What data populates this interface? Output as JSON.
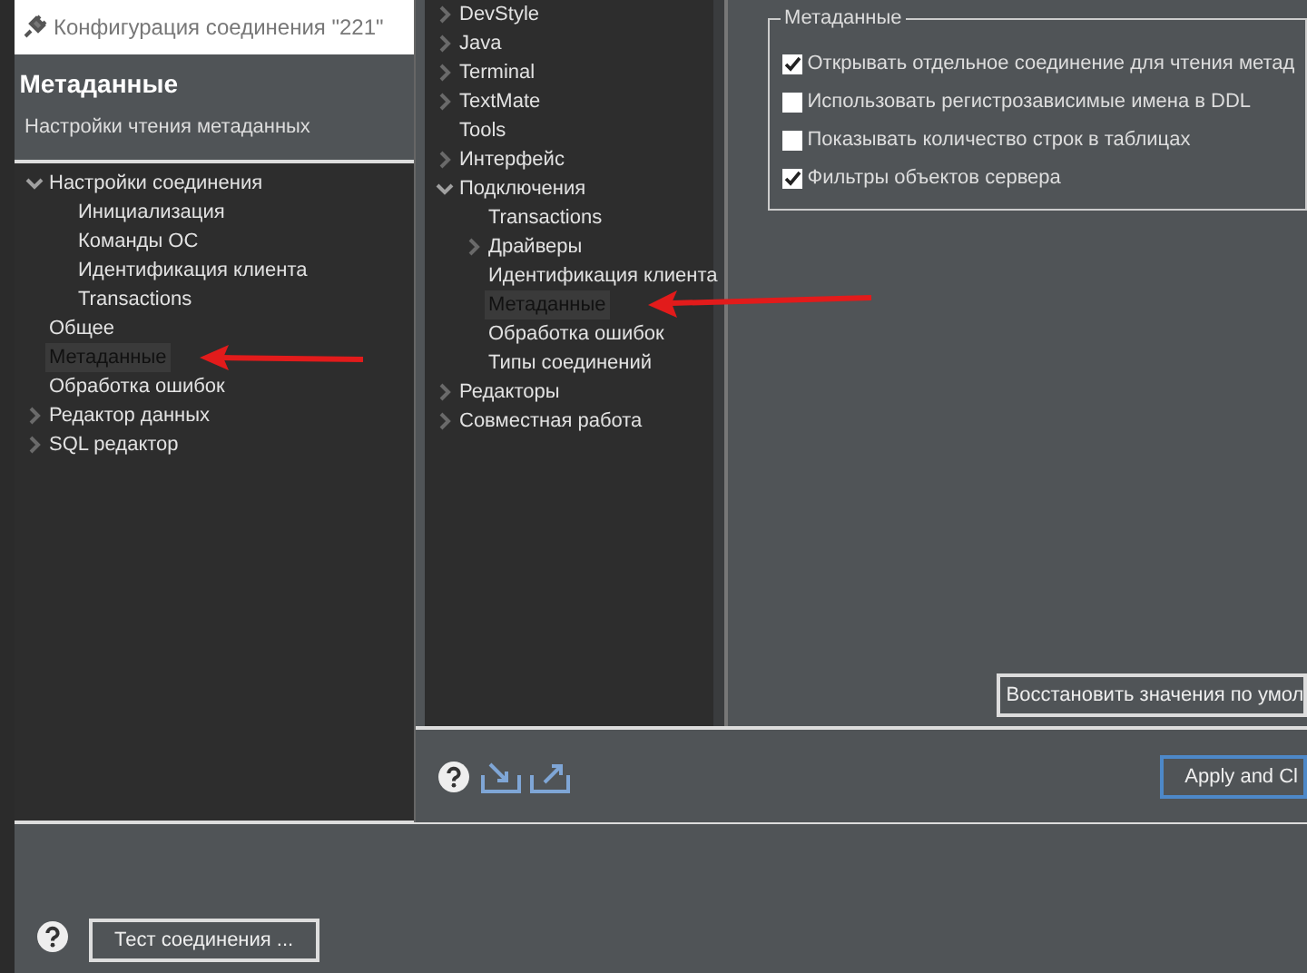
{
  "connection_dialog": {
    "title": "Конфигурация соединения \"221\"",
    "header": {
      "title": "Метаданные",
      "subtitle": "Настройки чтения метаданных"
    },
    "tree": [
      {
        "label": "Настройки соединения",
        "expanded": true,
        "selected": false,
        "children": [
          {
            "label": "Инициализация",
            "selected": false
          },
          {
            "label": "Команды ОС",
            "selected": false
          },
          {
            "label": "Идентификация клиента",
            "selected": false
          },
          {
            "label": "Transactions",
            "selected": false
          }
        ]
      },
      {
        "label": "Общее",
        "selected": false
      },
      {
        "label": "Метаданные",
        "selected": true
      },
      {
        "label": "Обработка ошибок",
        "selected": false
      },
      {
        "label": "Редактор данных",
        "expanded": false,
        "selected": false
      },
      {
        "label": "SQL редактор",
        "expanded": false,
        "selected": false
      }
    ],
    "test_button": "Тест соединения ..."
  },
  "preferences": {
    "tree": [
      {
        "label": "DevStyle",
        "expanded": false,
        "selected": false
      },
      {
        "label": "Java",
        "expanded": false,
        "selected": false
      },
      {
        "label": "Terminal",
        "expanded": false,
        "selected": false
      },
      {
        "label": "TextMate",
        "expanded": false,
        "selected": false
      },
      {
        "label": "Tools",
        "selected": false
      },
      {
        "label": "Интерфейс",
        "expanded": false,
        "selected": false
      },
      {
        "label": "Подключения",
        "expanded": true,
        "selected": false,
        "children": [
          {
            "label": "Transactions",
            "selected": false
          },
          {
            "label": "Драйверы",
            "expanded": false,
            "selected": false
          },
          {
            "label": "Идентификация клиента",
            "selected": false
          },
          {
            "label": "Метаданные",
            "selected": true
          },
          {
            "label": "Обработка ошибок",
            "selected": false
          },
          {
            "label": "Типы соединений",
            "selected": false
          }
        ]
      },
      {
        "label": "Редакторы",
        "expanded": false,
        "selected": false
      },
      {
        "label": "Совместная работа",
        "expanded": false,
        "selected": false
      }
    ],
    "group": {
      "title": "Метаданные",
      "options": [
        {
          "label": "Открывать отдельное соединение для чтения метад",
          "checked": true
        },
        {
          "label": "Использовать регистрозависимые имена в DDL",
          "checked": false
        },
        {
          "label": "Показывать количество строк в таблицах",
          "checked": false
        },
        {
          "label": "Фильтры объектов сервера",
          "checked": true
        }
      ]
    },
    "restore_button": "Восстановить значения по умол",
    "apply_button": "Apply and Cl"
  }
}
